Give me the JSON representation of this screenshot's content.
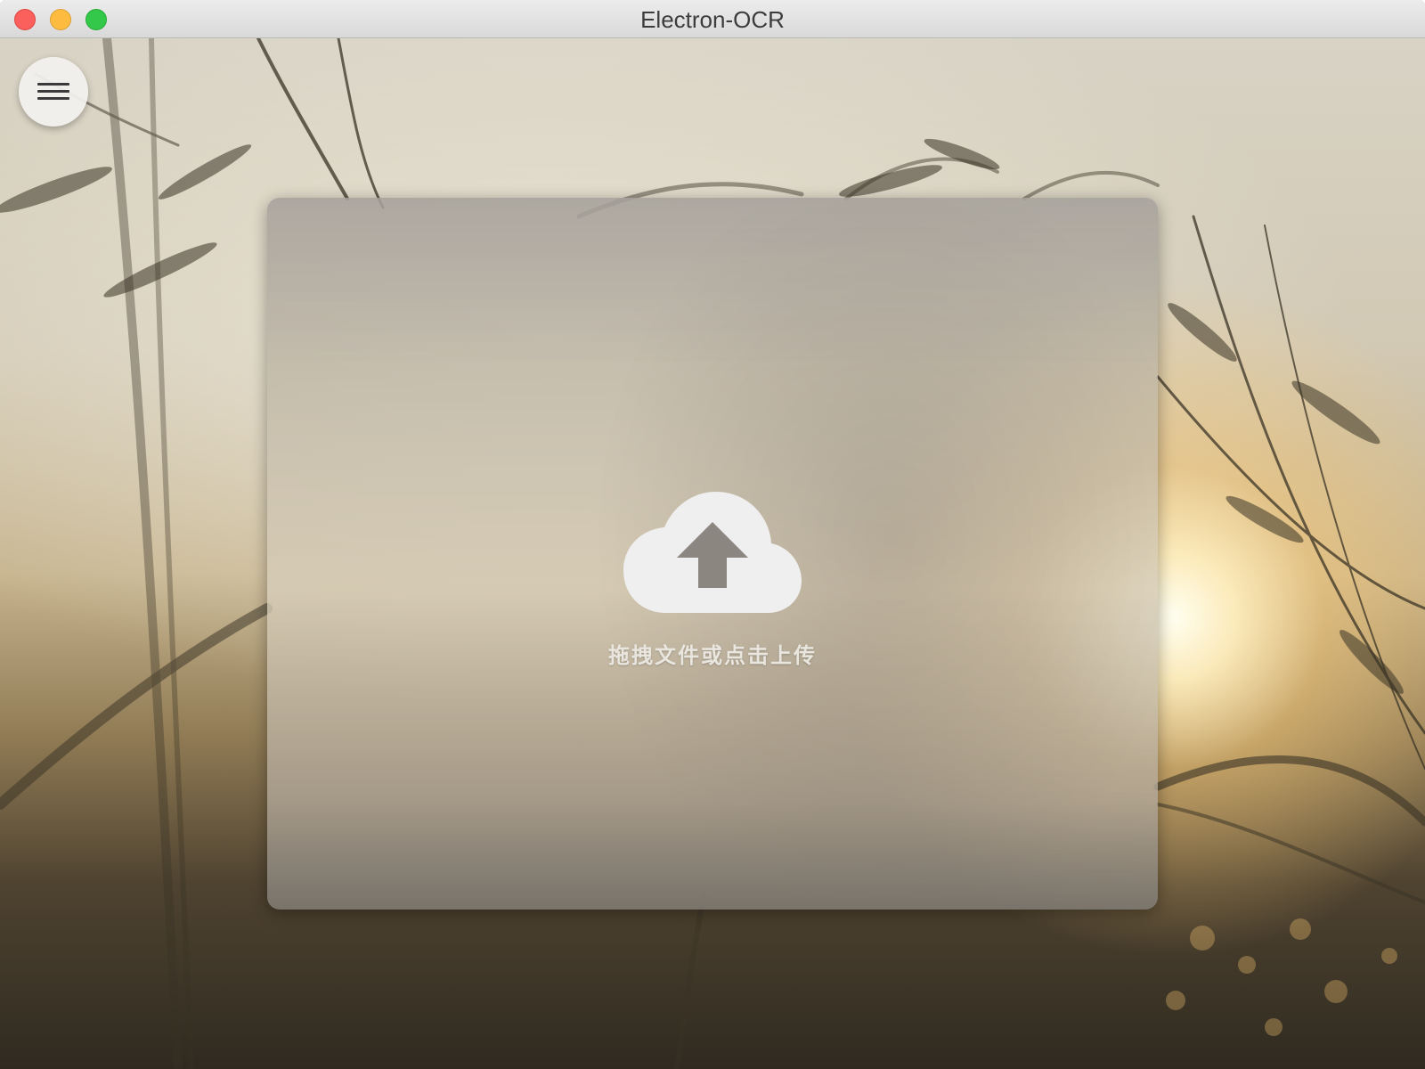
{
  "window": {
    "title": "Electron-OCR"
  },
  "traffic_lights": {
    "close": "close-button",
    "minimize": "minimize-button",
    "maximize": "maximize-button"
  },
  "menu_button": {
    "icon": "hamburger-menu-icon"
  },
  "upload_panel": {
    "icon": "cloud-upload-icon",
    "label": "拖拽文件或点击上传"
  },
  "colors": {
    "close": "#fc605c",
    "minimize": "#fdbc40",
    "maximize": "#34c84a",
    "upload_icon": "#efefef",
    "upload_text": "#e9e6e0"
  }
}
